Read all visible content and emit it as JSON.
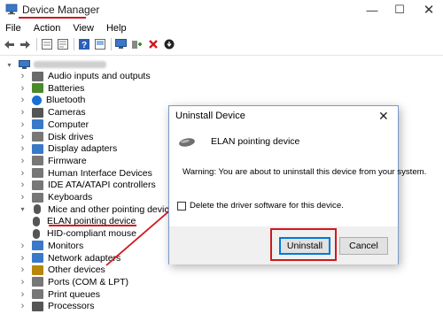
{
  "window": {
    "title": "Device Manager",
    "controls": {
      "minimize": "—",
      "maximize": "☐",
      "close": "✕"
    }
  },
  "menu": [
    "File",
    "Action",
    "View",
    "Help"
  ],
  "toolbar": {
    "icons": [
      "back-arrow-icon",
      "forward-arrow-icon",
      "tree-view-icon",
      "properties-icon",
      "help-icon",
      "scan-hardware-icon",
      "monitor-icon",
      "update-driver-icon",
      "uninstall-x-icon",
      "disable-device-icon"
    ]
  },
  "tree": {
    "items": [
      {
        "label": "Audio inputs and outputs",
        "icon": "speaker-icon",
        "color": "#6a6a6a"
      },
      {
        "label": "Batteries",
        "icon": "battery-icon",
        "color": "#4a8a2a"
      },
      {
        "label": "Bluetooth",
        "icon": "bluetooth-icon",
        "color": "#1a6fd4"
      },
      {
        "label": "Cameras",
        "icon": "camera-icon",
        "color": "#555555"
      },
      {
        "label": "Computer",
        "icon": "computer-icon",
        "color": "#3a78c8"
      },
      {
        "label": "Disk drives",
        "icon": "disk-drive-icon",
        "color": "#777777"
      },
      {
        "label": "Display adapters",
        "icon": "display-adapter-icon",
        "color": "#3a78c8"
      },
      {
        "label": "Firmware",
        "icon": "firmware-icon",
        "color": "#777777"
      },
      {
        "label": "Human Interface Devices",
        "icon": "hid-icon",
        "color": "#777777"
      },
      {
        "label": "IDE ATA/ATAPI controllers",
        "icon": "ide-controller-icon",
        "color": "#777777"
      },
      {
        "label": "Keyboards",
        "icon": "keyboard-icon",
        "color": "#777777"
      },
      {
        "label": "Mice and other pointing devices",
        "icon": "mouse-icon",
        "color": "#555555",
        "expanded": true
      },
      {
        "label": "ELAN pointing device",
        "icon": "mouse-icon",
        "color": "#555555",
        "child": true
      },
      {
        "label": "HID-compliant mouse",
        "icon": "mouse-icon",
        "color": "#555555",
        "child": true
      },
      {
        "label": "Monitors",
        "icon": "monitor-icon",
        "color": "#3a78c8"
      },
      {
        "label": "Network adapters",
        "icon": "network-adapter-icon",
        "color": "#3a78c8"
      },
      {
        "label": "Other devices",
        "icon": "other-devices-icon",
        "color": "#b8860b"
      },
      {
        "label": "Ports (COM & LPT)",
        "icon": "port-icon",
        "color": "#777777"
      },
      {
        "label": "Print queues",
        "icon": "printer-icon",
        "color": "#777777"
      },
      {
        "label": "Processors",
        "icon": "processor-icon",
        "color": "#555555"
      }
    ]
  },
  "dialog": {
    "title": "Uninstall Device",
    "device_name": "ELAN pointing device",
    "warning": "Warning: You are about to uninstall this device from your system.",
    "checkbox_label": "Delete the driver software for this device.",
    "checkbox_checked": false,
    "uninstall_label": "Uninstall",
    "cancel_label": "Cancel"
  },
  "colors": {
    "annotation_red": "#d0181e",
    "focus_blue": "#0078d7"
  }
}
